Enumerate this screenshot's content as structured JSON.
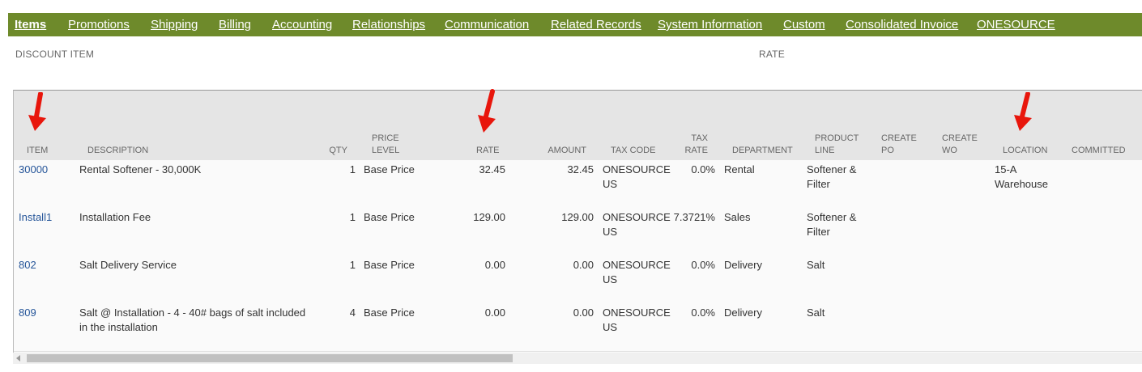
{
  "tabs": [
    {
      "label": "Items",
      "active": true
    },
    {
      "label": "Promotions",
      "active": false
    },
    {
      "label": "Shipping",
      "active": false
    },
    {
      "label": "Billing",
      "active": false
    },
    {
      "label": "Accounting",
      "active": false
    },
    {
      "label": "Relationships",
      "active": false
    },
    {
      "label": "Communication",
      "active": false
    },
    {
      "label": "Related Records",
      "active": false
    },
    {
      "label": "System Information",
      "active": false
    },
    {
      "label": "Custom",
      "active": false
    },
    {
      "label": "Consolidated Invoice",
      "active": false
    },
    {
      "label": "ONESOURCE",
      "active": false
    }
  ],
  "fields": {
    "discount_item_label": "DISCOUNT ITEM",
    "rate_label": "RATE"
  },
  "table": {
    "columns": {
      "item": "ITEM",
      "description": "DESCRIPTION",
      "qty": "QTY",
      "price_level_1": "PRICE",
      "price_level_2": "LEVEL",
      "rate": "RATE",
      "amount": "AMOUNT",
      "tax_code": "TAX CODE",
      "tax_rate_1": "TAX",
      "tax_rate_2": "RATE",
      "department": "DEPARTMENT",
      "product_line_1": "PRODUCT",
      "product_line_2": "LINE",
      "create_po_1": "CREATE",
      "create_po_2": "PO",
      "create_wo_1": "CREATE",
      "create_wo_2": "WO",
      "location": "LOCATION",
      "committed": "COMMITTED"
    },
    "rows": [
      {
        "item": "30000",
        "description_1": "Rental Softener - 30,000K",
        "description_2": "",
        "qty": "1",
        "price_level": "Base Price",
        "rate": "32.45",
        "amount": "32.45",
        "tax_code_1": "ONESOURCE",
        "tax_code_2": "US",
        "tax_rate": "0.0%",
        "department": "Rental",
        "product_line_1": "Softener &",
        "product_line_2": "Filter",
        "location_1": "15-A",
        "location_2": "Warehouse"
      },
      {
        "item": "Install1",
        "description_1": "Installation Fee",
        "description_2": "",
        "qty": "1",
        "price_level": "Base Price",
        "rate": "129.00",
        "amount": "129.00",
        "tax_code_1": "ONESOURCE",
        "tax_code_2": "US",
        "tax_rate": "7.3721%",
        "department": "Sales",
        "product_line_1": "Softener &",
        "product_line_2": "Filter",
        "location_1": "",
        "location_2": ""
      },
      {
        "item": "802",
        "description_1": "Salt Delivery Service",
        "description_2": "",
        "qty": "1",
        "price_level": "Base Price",
        "rate": "0.00",
        "amount": "0.00",
        "tax_code_1": "ONESOURCE",
        "tax_code_2": "US",
        "tax_rate": "0.0%",
        "department": "Delivery",
        "product_line_1": "Salt",
        "product_line_2": "",
        "location_1": "",
        "location_2": ""
      },
      {
        "item": "809",
        "description_1": "Salt @ Installation - 4 - 40# bags of salt included",
        "description_2": "in the installation",
        "qty": "4",
        "price_level": "Base Price",
        "rate": "0.00",
        "amount": "0.00",
        "tax_code_1": "ONESOURCE",
        "tax_code_2": "US",
        "tax_rate": "0.0%",
        "department": "Delivery",
        "product_line_1": "Salt",
        "product_line_2": "",
        "location_1": "",
        "location_2": ""
      }
    ]
  },
  "colors": {
    "tab_bar": "#6e8a2b",
    "link": "#255599",
    "annotation_arrow": "#e8160c"
  }
}
